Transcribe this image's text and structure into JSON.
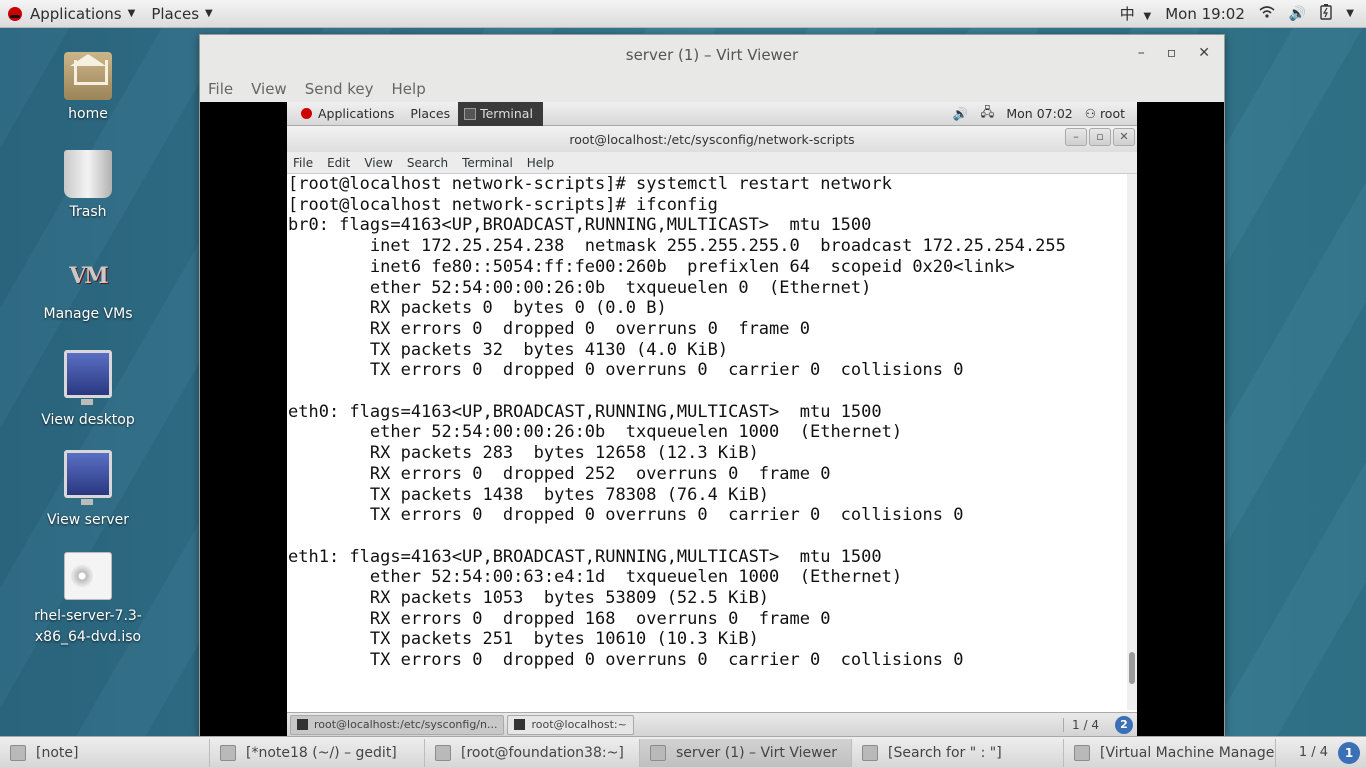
{
  "top_panel": {
    "applications": "Applications",
    "places": "Places",
    "input_method": "中",
    "clock": "Mon 19:02"
  },
  "desktop_icons": [
    {
      "label": "home"
    },
    {
      "label": "Trash"
    },
    {
      "label": "Manage VMs"
    },
    {
      "label": "View desktop"
    },
    {
      "label": "View server"
    },
    {
      "label": "rhel-server-7.3-\nx86_64-dvd.iso"
    }
  ],
  "viewer": {
    "title": "server (1) – Virt Viewer",
    "menu": [
      "File",
      "View",
      "Send key",
      "Help"
    ]
  },
  "guest": {
    "top_panel": {
      "applications": "Applications",
      "places": "Places",
      "terminal_label": "Terminal",
      "clock": "Mon 07:02",
      "user": "root"
    },
    "terminal": {
      "title": "root@localhost:/etc/sysconfig/network-scripts",
      "menu": [
        "File",
        "Edit",
        "View",
        "Search",
        "Terminal",
        "Help"
      ],
      "lines": [
        "[root@localhost network-scripts]# systemctl restart network",
        "[root@localhost network-scripts]# ifconfig",
        "br0: flags=4163<UP,BROADCAST,RUNNING,MULTICAST>  mtu 1500",
        "        inet 172.25.254.238  netmask 255.255.255.0  broadcast 172.25.254.255",
        "        inet6 fe80::5054:ff:fe00:260b  prefixlen 64  scopeid 0x20<link>",
        "        ether 52:54:00:00:26:0b  txqueuelen 0  (Ethernet)",
        "        RX packets 0  bytes 0 (0.0 B)",
        "        RX errors 0  dropped 0  overruns 0  frame 0",
        "        TX packets 32  bytes 4130 (4.0 KiB)",
        "        TX errors 0  dropped 0 overruns 0  carrier 0  collisions 0",
        "",
        "eth0: flags=4163<UP,BROADCAST,RUNNING,MULTICAST>  mtu 1500",
        "        ether 52:54:00:00:26:0b  txqueuelen 1000  (Ethernet)",
        "        RX packets 283  bytes 12658 (12.3 KiB)",
        "        RX errors 0  dropped 252  overruns 0  frame 0",
        "        TX packets 1438  bytes 78308 (76.4 KiB)",
        "        TX errors 0  dropped 0 overruns 0  carrier 0  collisions 0",
        "",
        "eth1: flags=4163<UP,BROADCAST,RUNNING,MULTICAST>  mtu 1500",
        "        ether 52:54:00:63:e4:1d  txqueuelen 1000  (Ethernet)",
        "        RX packets 1053  bytes 53809 (52.5 KiB)",
        "        RX errors 0  dropped 168  overruns 0  frame 0",
        "        TX packets 251  bytes 10610 (10.3 KiB)",
        "        TX errors 0  dropped 0 overruns 0  carrier 0  collisions 0"
      ]
    },
    "taskbar": {
      "tasks": [
        "root@localhost:/etc/sysconfig/n...",
        "root@localhost:~"
      ],
      "pager": "1 / 4"
    }
  },
  "taskbar": {
    "tasks": [
      "[note]",
      "[*note18 (~/) – gedit]",
      "[root@foundation38:~]",
      "server (1) – Virt Viewer",
      "[Search for \" : \"]",
      "[Virtual Machine Manager]"
    ],
    "pager": "1 / 4"
  }
}
